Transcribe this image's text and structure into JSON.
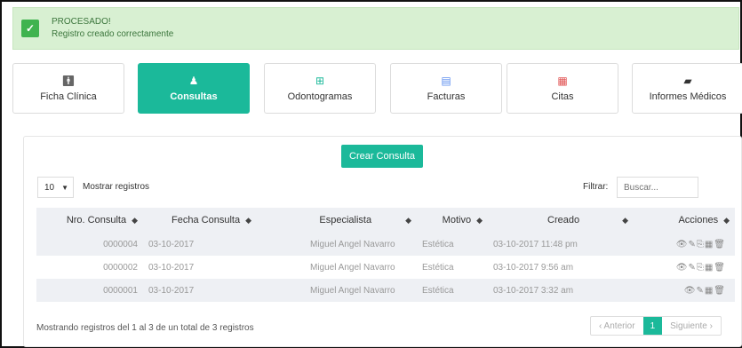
{
  "alert": {
    "title": "PROCESADO!",
    "message": "Registro creado correctamente",
    "icon": "check-icon"
  },
  "tabs": [
    {
      "label": "Ficha Clínica",
      "icon": "person-icon",
      "glyph": "🯅"
    },
    {
      "label": "Consultas",
      "icon": "users-icon",
      "glyph": "👥"
    },
    {
      "label": "Odontogramas",
      "icon": "grid-plus-icon",
      "glyph": "⊞"
    },
    {
      "label": "Facturas",
      "icon": "file-icon",
      "glyph": "▤"
    },
    {
      "label": "Citas",
      "icon": "calendar-icon",
      "glyph": "▦"
    },
    {
      "label": "Informes Médicos",
      "icon": "folder-open-icon",
      "glyph": "▰"
    }
  ],
  "panel": {
    "create_label": "Crear Consulta",
    "length_value": "10",
    "length_label": "Mostrar registros",
    "filter_label": "Filtrar:",
    "filter_placeholder": "Buscar..."
  },
  "table": {
    "headers": [
      "Nro. Consulta",
      "Fecha Consulta",
      "Especialista",
      "Motivo",
      "Creado",
      "Acciones"
    ],
    "rows": [
      {
        "nro": "0000004",
        "fecha": "03-10-2017",
        "especialista": "Miguel Angel Navarro",
        "motivo": "Estética",
        "creado": "03-10-2017 11:48 pm",
        "acciones": "👁✎⎘▦🗑"
      },
      {
        "nro": "0000002",
        "fecha": "03-10-2017",
        "especialista": "Miguel Angel Navarro",
        "motivo": "Estética",
        "creado": "03-10-2017 9:56 am",
        "acciones": "👁✎⎘▦🗑"
      },
      {
        "nro": "0000001",
        "fecha": "03-10-2017",
        "especialista": "Miguel Angel Navarro",
        "motivo": "Estética",
        "creado": "03-10-2017 3:32 am",
        "acciones": "👁✎▦🗑"
      }
    ]
  },
  "footer": {
    "info": "Mostrando registros del 1 al 3 de un total de 3 registros",
    "prev": "‹ Anterior",
    "current_page": "1",
    "next": "Siguiente ›"
  }
}
